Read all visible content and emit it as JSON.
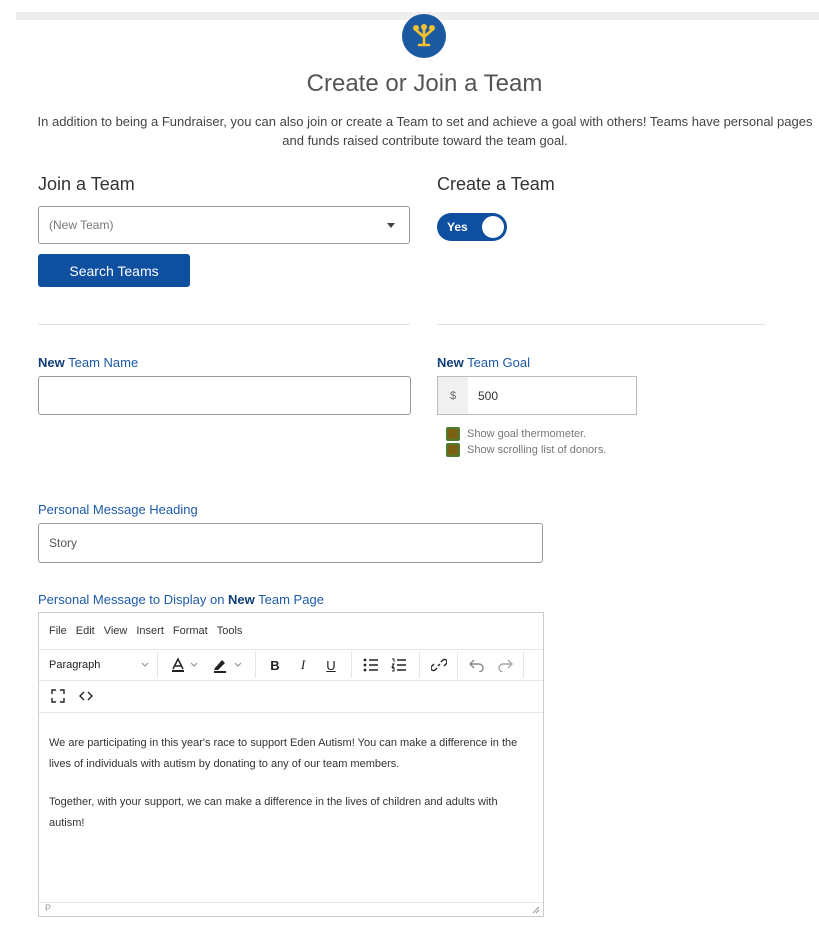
{
  "page": {
    "title": "Create or Join a Team",
    "intro": "In addition to being a Fundraiser, you can also join or create a Team to set and achieve a goal with others! Teams have personal pages and funds raised contribute toward the team goal."
  },
  "join": {
    "title": "Join a Team",
    "select_value": "(New Team)",
    "search_button": "Search Teams"
  },
  "create": {
    "title": "Create a Team",
    "toggle_label": "Yes"
  },
  "team_name": {
    "label_bold": "New",
    "label_rest": " Team Name",
    "value": ""
  },
  "team_goal": {
    "label_bold": "New",
    "label_rest": " Team Goal",
    "currency": "$",
    "value": "500",
    "options": [
      "Show goal thermometer.",
      "Show scrolling list of donors."
    ]
  },
  "message_heading": {
    "label": "Personal Message Heading",
    "value": "Story"
  },
  "message": {
    "label_pre": "Personal Message to Display on ",
    "label_bold": "New",
    "label_post": " Team Page",
    "menu": [
      "File",
      "Edit",
      "View",
      "Insert",
      "Format",
      "Tools"
    ],
    "block_format": "Paragraph",
    "body": [
      "We are participating in this year's race to support Eden Autism! You can make a difference in the lives of individuals with autism by donating to any of our team members.",
      "Together, with your support, we can make a difference in the lives of children and adults with autism!"
    ],
    "status_path": "P"
  },
  "colors": {
    "primary": "#0f4fa0",
    "label_blue": "#1d5aa8",
    "logo_gold": "#f2c12e"
  }
}
